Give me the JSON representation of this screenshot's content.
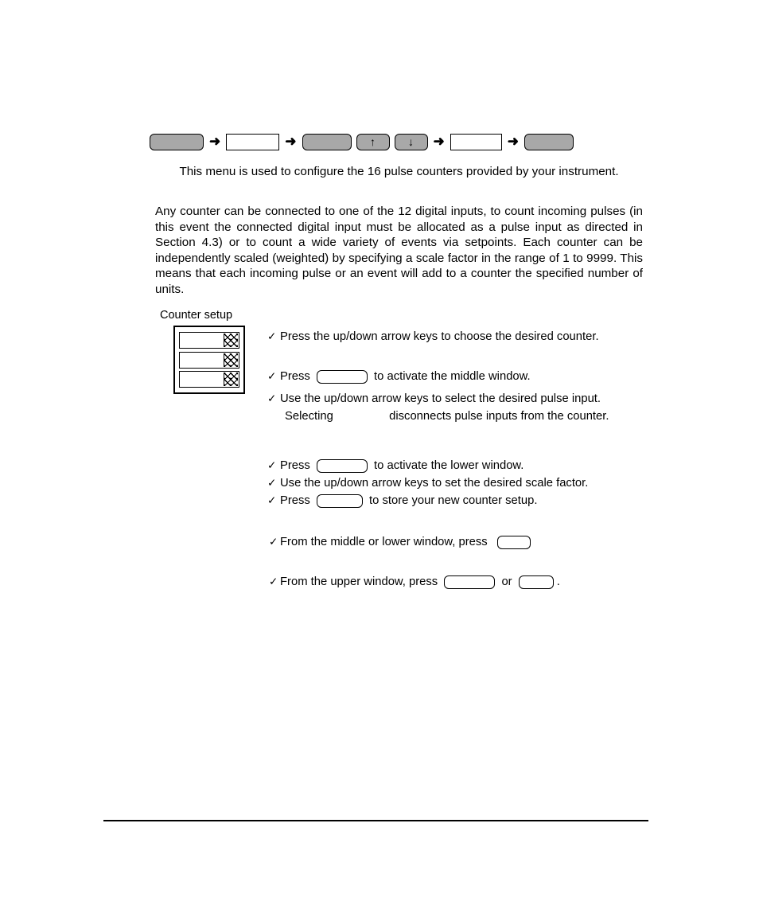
{
  "key_sequence": {
    "separator_icon": "right-arrow-icon",
    "keys": [
      {
        "name": "menu-key",
        "style": "gray",
        "label": ""
      },
      {
        "name": "display-key",
        "style": "white",
        "label": ""
      },
      {
        "name": "function-key",
        "style": "gray",
        "label": ""
      },
      {
        "name": "up-arrow-key",
        "style": "arrowkey",
        "label": "↑"
      },
      {
        "name": "down-arrow-key",
        "style": "arrowkey",
        "label": "↓"
      },
      {
        "name": "value-key",
        "style": "white",
        "label": ""
      },
      {
        "name": "enter-key",
        "style": "gray",
        "label": ""
      }
    ]
  },
  "intro_paragraph": "This menu is used to configure the 16 pulse counters provided by your instrument.",
  "detail_paragraph": "Any counter can be connected to one of the 12 digital inputs, to count incoming pulses (in this event the connected digital input must be allocated as a pulse input as directed in Section 4.3) or to count a wide variety of events via setpoints. Each counter can be independently scaled (weighted) by specifying a scale factor in the range of 1 to 9999. This means that each incoming pulse or an event will add to a counter the specified number of units.",
  "figure": {
    "label": "Counter setup",
    "window_count": 3,
    "window_names": [
      "upper-window",
      "middle-window",
      "lower-window"
    ],
    "hatch_icon": "zigzag-hatch-icon"
  },
  "bullets": {
    "check_icon": "✓",
    "items": [
      {
        "name": "bullet-choose-counter",
        "parts": [
          {
            "type": "text",
            "value": "Press the up/down arrow keys to choose the desired counter."
          }
        ]
      },
      {
        "name": "bullet-activate-middle-window",
        "parts": [
          {
            "type": "text",
            "value": "Press "
          },
          {
            "type": "key",
            "name": "activate-middle-window-key",
            "width": "64"
          },
          {
            "type": "text",
            "value": " to activate the middle window."
          }
        ]
      },
      {
        "name": "bullet-select-pulse-input",
        "parts": [
          {
            "type": "text",
            "value": "Use the up/down arrow keys to select the desired pulse input."
          }
        ]
      },
      {
        "name": "bullet-selecting-disconnects",
        "parts": [
          {
            "type": "text",
            "value": "Selecting"
          },
          {
            "type": "gap",
            "name": "missing-key-image"
          },
          {
            "type": "text",
            "value": "disconnects pulse inputs from the counter."
          }
        ]
      },
      {
        "name": "bullet-activate-lower-window",
        "parts": [
          {
            "type": "text",
            "value": "Press "
          },
          {
            "type": "key",
            "name": "activate-lower-window-key",
            "width": "64"
          },
          {
            "type": "text",
            "value": " to activate the lower window."
          }
        ]
      },
      {
        "name": "bullet-set-scale-factor",
        "parts": [
          {
            "type": "text",
            "value": "Use the up/down arrow keys to set the desired scale factor."
          }
        ]
      },
      {
        "name": "bullet-store-counter-setup",
        "parts": [
          {
            "type": "text",
            "value": "Press "
          },
          {
            "type": "key",
            "name": "store-counter-setup-key",
            "width": "58"
          },
          {
            "type": "text",
            "value": " to store your new counter setup."
          }
        ]
      },
      {
        "name": "bullet-from-middle-or-lower",
        "parts": [
          {
            "type": "text",
            "value": "From the middle or lower window, press "
          },
          {
            "type": "key",
            "name": "exit-window-key",
            "width": "42"
          }
        ]
      },
      {
        "name": "bullet-from-upper-window",
        "parts": [
          {
            "type": "text",
            "value": "From the upper window, press "
          },
          {
            "type": "key",
            "name": "upper-window-key-1",
            "width": "64"
          },
          {
            "type": "text",
            "value": " or "
          },
          {
            "type": "key",
            "name": "upper-window-key-2",
            "width": "44"
          },
          {
            "type": "text",
            "value": "."
          }
        ]
      }
    ]
  },
  "colors": {
    "key_gray": "#a8a8a8",
    "key_white": "#ffffff",
    "ink": "#000000",
    "page": "#ffffff"
  }
}
